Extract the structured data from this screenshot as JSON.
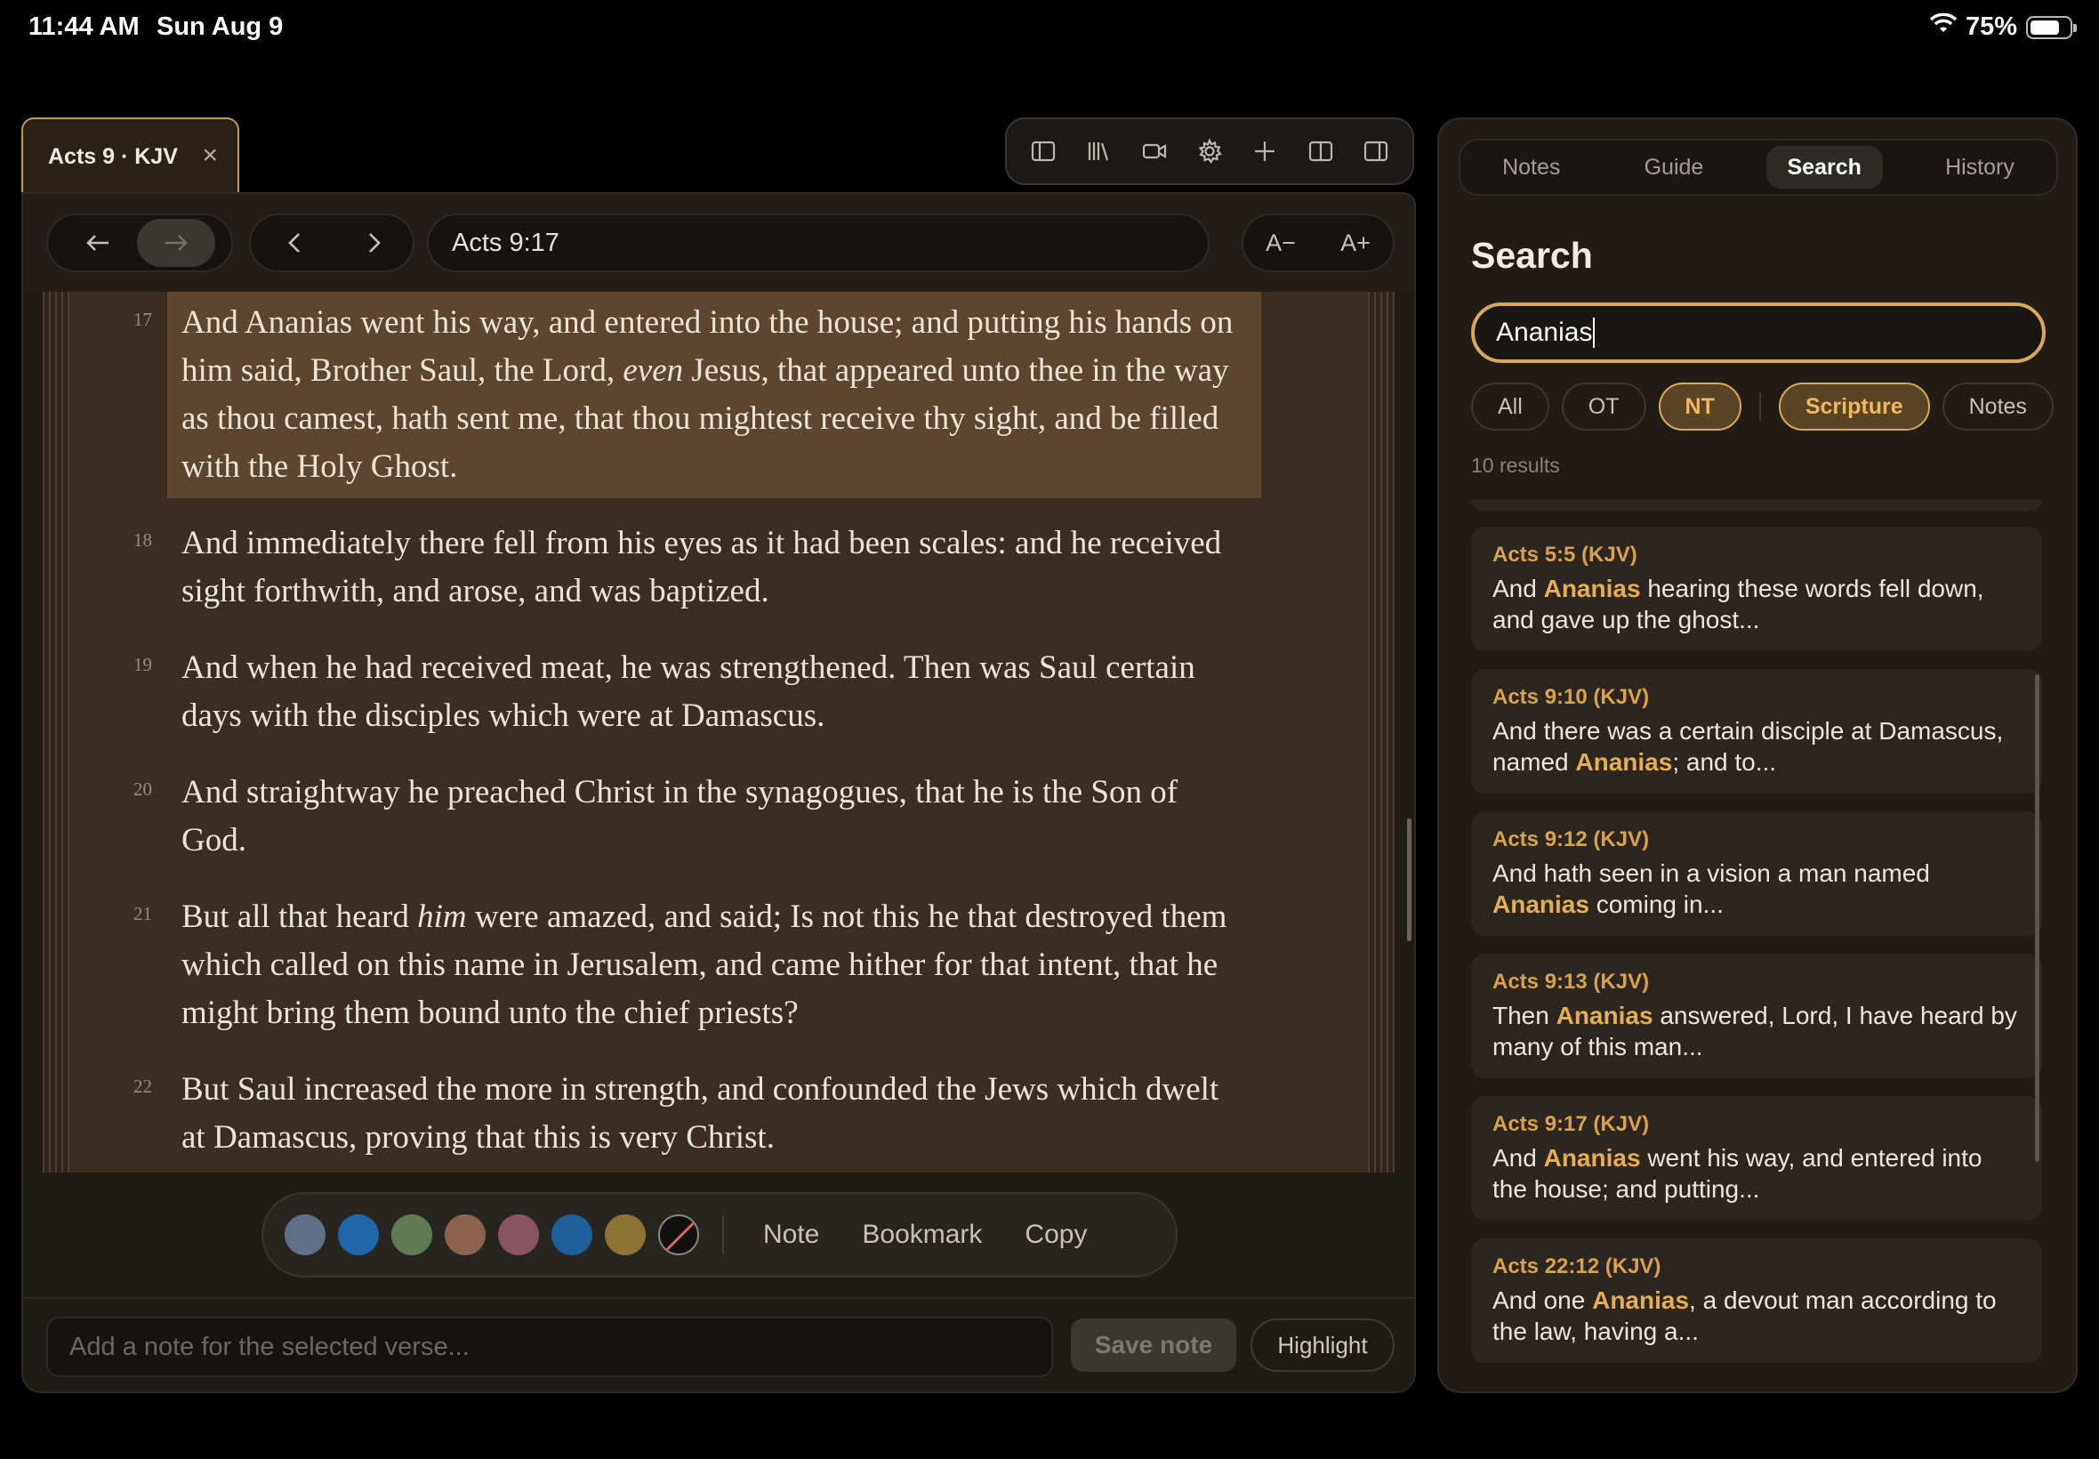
{
  "status": {
    "time": "11:44 AM",
    "date": "Sun Aug 9",
    "battery": "75%",
    "battery_level": 0.75
  },
  "tab": {
    "title": "Acts 9 · KJV",
    "close_glyph": "×"
  },
  "toolbar_icons": [
    "sidebar-left-icon",
    "library-icon",
    "video-icon",
    "gear-icon",
    "plus-icon",
    "split-view-icon",
    "sidebar-right-icon"
  ],
  "nav": {
    "reference": "Acts 9:17",
    "font_decrease": "A−",
    "font_increase": "A+"
  },
  "verses": [
    {
      "num": "17",
      "before": "And Ananias went his way, and entered into the house; and putting his hands on him said, Brother Saul, the Lord, ",
      "italic": "even",
      "after": " Jesus, that appeared unto thee in the way as thou camest, hath sent me, that thou mightest receive thy sight, and be filled with the Holy Ghost.",
      "selected": true
    },
    {
      "num": "18",
      "before": "And immediately there fell from his eyes as it had been scales: and he received sight forthwith, and arose, and was baptized.",
      "italic": "",
      "after": ""
    },
    {
      "num": "19",
      "before": "And when he had received meat, he was strengthened. Then was Saul certain days with the disciples which were at Damascus.",
      "italic": "",
      "after": ""
    },
    {
      "num": "20",
      "before": "And straightway he preached Christ in the synagogues, that he is the Son of God.",
      "italic": "",
      "after": ""
    },
    {
      "num": "21",
      "before": "But all that heard ",
      "italic": "him",
      "after": " were amazed, and said; Is not this he that destroyed them which called on this name in Jerusalem, and came hither for that intent, that he might bring them bound unto the chief priests?"
    },
    {
      "num": "22",
      "before": "But Saul increased the more in strength, and confounded the Jews which dwelt at Damascus, proving that this is very Christ.",
      "italic": "",
      "after": ""
    }
  ],
  "highlight_colors": [
    "#5f7088",
    "#1f67a8",
    "#5f7a55",
    "#8b6350",
    "#8a5364",
    "#1e5f9c",
    "#8a7333"
  ],
  "highlighter": {
    "note": "Note",
    "bookmark": "Bookmark",
    "copy": "Copy"
  },
  "note_bar": {
    "placeholder": "Add a note for the selected verse...",
    "save": "Save note",
    "highlight": "Highlight"
  },
  "side": {
    "tabs": [
      "Notes",
      "Guide",
      "Search",
      "History"
    ],
    "active_tab": "Search",
    "title": "Search",
    "query": "Ananias",
    "filters": {
      "all": "All",
      "ot": "OT",
      "nt": "NT",
      "scripture": "Scripture",
      "notes": "Notes"
    },
    "result_count": "10 results",
    "results": [
      {
        "ref": "Acts 5:5 (KJV)",
        "pre": "And ",
        "match": "Ananias",
        "post": " hearing these words fell down, and gave up the ghost..."
      },
      {
        "ref": "Acts 9:10 (KJV)",
        "pre": "And there was a certain disciple at Damascus, named ",
        "match": "Ananias",
        "post": "; and to..."
      },
      {
        "ref": "Acts 9:12 (KJV)",
        "pre": "And hath seen in a vision a man named ",
        "match": "Ananias",
        "post": " coming in..."
      },
      {
        "ref": "Acts 9:13 (KJV)",
        "pre": "Then ",
        "match": "Ananias",
        "post": " answered, Lord, I have heard by many of this man..."
      },
      {
        "ref": "Acts 9:17 (KJV)",
        "pre": "And ",
        "match": "Ananias",
        "post": " went his way, and entered into the house; and putting..."
      },
      {
        "ref": "Acts 22:12 (KJV)",
        "pre": "And one ",
        "match": "Ananias",
        "post": ", a devout man according to the law, having a..."
      }
    ]
  },
  "colors": {
    "accent": "#d9a95b",
    "selected_verse": "#5c4630",
    "reader_bg": "#3a2e23"
  }
}
